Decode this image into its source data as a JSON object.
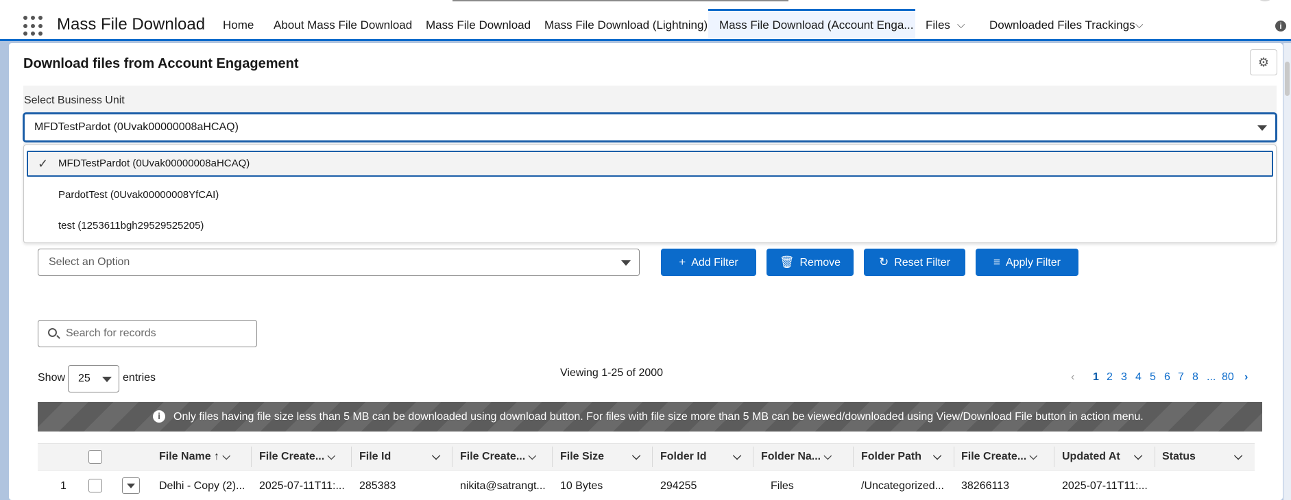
{
  "app": {
    "title": "Mass File Download"
  },
  "nav": {
    "tabs": [
      {
        "label": "Home"
      },
      {
        "label": "About Mass File Download"
      },
      {
        "label": "Mass File Download"
      },
      {
        "label": "Mass File Download (Lightning)"
      },
      {
        "label": "Mass File Download (Account Enga..."
      },
      {
        "label": "Files"
      },
      {
        "label": "Downloaded Files Trackings"
      }
    ]
  },
  "page": {
    "title": "Download files from Account Engagement"
  },
  "business_unit": {
    "label": "Select Business Unit",
    "selected": "MFDTestPardot (0Uvak00000008aHCAQ)",
    "options": [
      "MFDTestPardot (0Uvak00000008aHCAQ)",
      "PardotTest (0Uvak00000008YfCAI)",
      "test (1253611bgh29529525205)"
    ]
  },
  "filter": {
    "placeholder": "Select an Option",
    "buttons": {
      "add": "Add Filter",
      "remove": "Remove",
      "reset": "Reset Filter",
      "apply": "Apply Filter"
    }
  },
  "search": {
    "placeholder": "Search for records"
  },
  "entries": {
    "show_label": "Show",
    "value": "25",
    "suffix": "entries"
  },
  "viewing": "Viewing 1-25 of 2000",
  "pagination": {
    "pages": [
      "1",
      "2",
      "3",
      "4",
      "5",
      "6",
      "7",
      "8",
      "...",
      "80"
    ],
    "current": "1"
  },
  "notice": "Only files having file size less than 5 MB can be downloaded using download button. For files with file size more than 5 MB can be viewed/downloaded using View/Download File button in action menu.",
  "table": {
    "columns": [
      "File Name ↑",
      "File Create...",
      "File Id",
      "File Create...",
      "File Size",
      "Folder Id",
      "Folder Na...",
      "Folder Path",
      "File Create...",
      "Updated At",
      "Status"
    ],
    "rows": [
      [
        "1",
        "Delhi - Copy (2)...",
        "2025-07-11T11:...",
        "285383",
        "nikita@satrangt...",
        "10 Bytes",
        "294255",
        "Files",
        "/Uncategorized...",
        "38266113",
        "2025-07-11T11:...",
        ""
      ]
    ]
  },
  "colors": {
    "brand": "#0b6bcb",
    "focus": "#1b5ea8",
    "notice_bg": "#5c5c5c"
  }
}
